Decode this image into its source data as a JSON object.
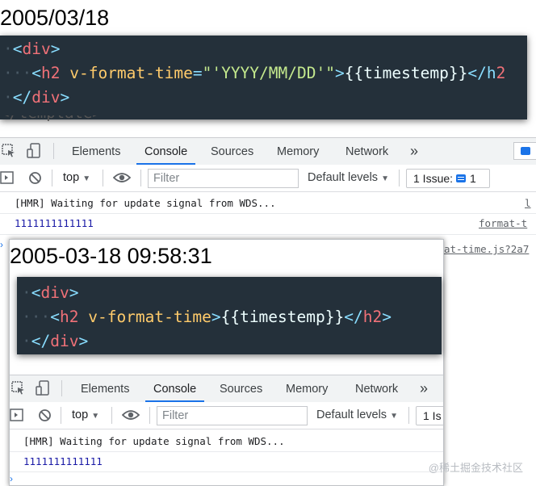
{
  "top": {
    "date_heading": "2005/03/18",
    "code": {
      "line1": [
        "<",
        "div",
        ">"
      ],
      "line2": [
        "<",
        "h2",
        " ",
        "v-format-time",
        "=",
        "\"'YYYY/MM/DD'\"",
        ">",
        "{{timestemp}}",
        "</h",
        "2"
      ],
      "line3": [
        "</",
        "div",
        ">"
      ],
      "partial_line": "</template>"
    },
    "devtools": {
      "tabs": [
        "Elements",
        "Console",
        "Sources",
        "Memory",
        "Network"
      ],
      "active_tab": "Console",
      "more_label": "»",
      "context": "top",
      "filter_placeholder": "Filter",
      "levels": "Default levels",
      "issue_label": "1 Issue:",
      "issue_count": "1",
      "logs": [
        {
          "text": "[HMR] Waiting for update signal from WDS...",
          "source": "l"
        },
        {
          "text": "1111111111111",
          "source": "format-t"
        }
      ],
      "hidden_source": "at-time.js?2a7"
    }
  },
  "bottom": {
    "date_heading": "2005-03-18 09:58:31",
    "code": {
      "line1": [
        "<",
        "div",
        ">"
      ],
      "line2": [
        "<",
        "h2",
        " ",
        "v-format-time",
        ">",
        "{{timestemp}}",
        "</",
        "h2",
        ">"
      ],
      "line3": [
        "</",
        "div",
        ">"
      ]
    },
    "devtools": {
      "tabs": [
        "Elements",
        "Console",
        "Sources",
        "Memory",
        "Network"
      ],
      "active_tab": "Console",
      "more_label": "»",
      "context": "top",
      "filter_placeholder": "Filter",
      "levels": "Default levels",
      "issue_label": "1 Is",
      "logs": [
        {
          "text": "[HMR] Waiting for update signal from WDS..."
        },
        {
          "text": "1111111111111"
        }
      ]
    }
  },
  "watermark": "@稀土掘金技术社区",
  "colors": {
    "accent": "#1a73e8",
    "code_bg": "#24303a",
    "log_number": "#1a1aa6"
  }
}
